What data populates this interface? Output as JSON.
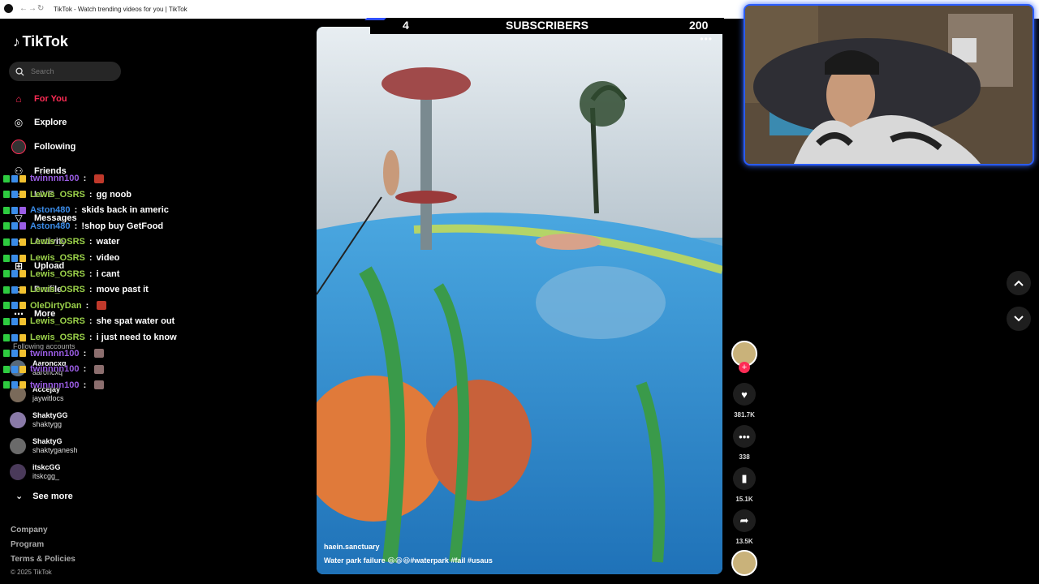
{
  "browser": {
    "tab_title": "TikTok - Watch trending videos for you | TikTok"
  },
  "sidebar": {
    "logo": "TikTok",
    "search_placeholder": "Search",
    "nav": [
      {
        "label": "For You",
        "icon": "home-icon",
        "active": true
      },
      {
        "label": "Explore",
        "icon": "compass-icon",
        "active": false
      },
      {
        "label": "Following",
        "icon": "following-icon",
        "active": false
      },
      {
        "label": "Friends",
        "icon": "friends-icon",
        "active": false
      },
      {
        "label": "LIVE",
        "icon": "live-icon",
        "active": false
      },
      {
        "label": "Messages",
        "icon": "messages-icon",
        "active": false
      },
      {
        "label": "Activity",
        "icon": "activity-icon",
        "active": false
      },
      {
        "label": "Upload",
        "icon": "upload-icon",
        "active": false
      },
      {
        "label": "Profile",
        "icon": "profile-icon",
        "active": false
      },
      {
        "label": "More",
        "icon": "more-icon",
        "active": false
      }
    ],
    "following_title": "Following accounts",
    "accounts": [
      {
        "name": "Aaroncxq",
        "handle": "aaroncxq"
      },
      {
        "name": "Accejay",
        "handle": "jaywitlocs"
      },
      {
        "name": "ShaktyGG",
        "handle": "shaktygg"
      },
      {
        "name": "ShaktyG",
        "handle": "shaktyganesh"
      },
      {
        "name": "itskcGG",
        "handle": "itskcgg_"
      }
    ],
    "see_more": "See more",
    "footer": [
      "Company",
      "Program",
      "Terms & Policies"
    ],
    "copyright": "© 2025 TikTok"
  },
  "chat": [
    {
      "user": "twinnnn100",
      "message": "",
      "color": "#9b5de5",
      "emote": true
    },
    {
      "user": "Lewis_OSRS",
      "message": "gg noob",
      "color": "#9bd24a",
      "emote": false
    },
    {
      "user": "Aston480",
      "message": "skids back in americ",
      "color": "#3b8ce8",
      "emote": false
    },
    {
      "user": "Aston480",
      "message": "!shop buy GetFood",
      "color": "#3b8ce8",
      "emote": false
    },
    {
      "user": "Lewis_OSRS",
      "message": "water",
      "color": "#9bd24a",
      "emote": false
    },
    {
      "user": "Lewis_OSRS",
      "message": "video",
      "color": "#9bd24a",
      "emote": false
    },
    {
      "user": "Lewis_OSRS",
      "message": "i cant",
      "color": "#9bd24a",
      "emote": false
    },
    {
      "user": "Lewis_OSRS",
      "message": "move past it",
      "color": "#9bd24a",
      "emote": false
    },
    {
      "user": "OleDirtyDan",
      "message": "",
      "color": "#9bd24a",
      "emote": true
    },
    {
      "user": "Lewis_OSRS",
      "message": "she spat water out",
      "color": "#9bd24a",
      "emote": false
    },
    {
      "user": "Lewis_OSRS",
      "message": "i just need to know",
      "color": "#9bd24a",
      "emote": false
    },
    {
      "user": "twinnnn100",
      "message": "",
      "color": "#9b5de5",
      "emote": true
    },
    {
      "user": "twinnnn100",
      "message": "",
      "color": "#9b5de5",
      "emote": true
    },
    {
      "user": "twinnnn100",
      "message": "",
      "color": "#9b5de5",
      "emote": true
    }
  ],
  "subscribers": {
    "current": "4",
    "label": "SUBSCRIBERS",
    "goal": "200",
    "accent_color": "#3050ff"
  },
  "video": {
    "author": "haein.sanctuary",
    "description": "Water park failure 😆😆😆#waterpark #fail #usaus",
    "menu": "•••"
  },
  "actions": {
    "likes": "381.7K",
    "comments": "338",
    "saves": "15.1K",
    "shares": "13.5K"
  },
  "colors": {
    "brand": "#fe2c55",
    "background": "#000000",
    "cam_border": "#2a5cff"
  }
}
